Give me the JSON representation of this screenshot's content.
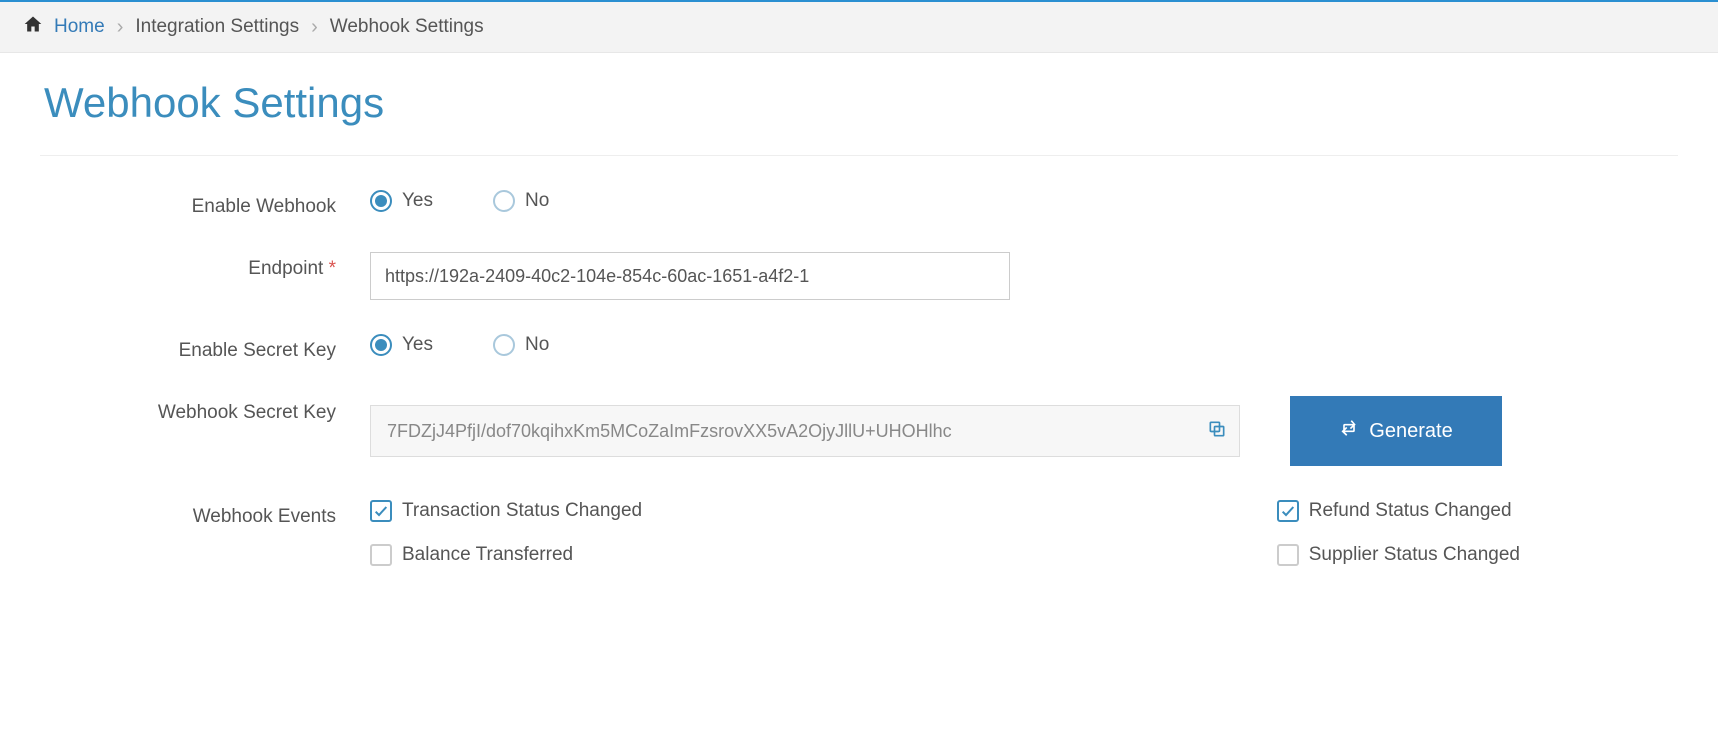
{
  "breadcrumb": {
    "home": "Home",
    "integration": "Integration Settings",
    "webhook": "Webhook Settings"
  },
  "title": "Webhook Settings",
  "labels": {
    "enable_webhook": "Enable Webhook",
    "endpoint": "Endpoint",
    "enable_secret": "Enable Secret Key",
    "secret_key": "Webhook Secret Key",
    "events": "Webhook Events"
  },
  "radios": {
    "yes": "Yes",
    "no": "No"
  },
  "endpoint_value": "https://192a-2409-40c2-104e-854c-60ac-1651-a4f2-1",
  "secret_value": "7FDZjJ4PfjI/dof70kqihxKm5MCoZaImFzsrovXX5vA2OjyJllU+UHOHlhc",
  "generate_label": "Generate",
  "events": {
    "tx_status": "Transaction Status Changed",
    "balance": "Balance Transferred",
    "refund": "Refund Status Changed",
    "supplier": "Supplier Status Changed"
  },
  "events_checked": {
    "tx_status": true,
    "balance": false,
    "refund": true,
    "supplier": false
  },
  "enable_webhook_value": "yes",
  "enable_secret_value": "yes"
}
